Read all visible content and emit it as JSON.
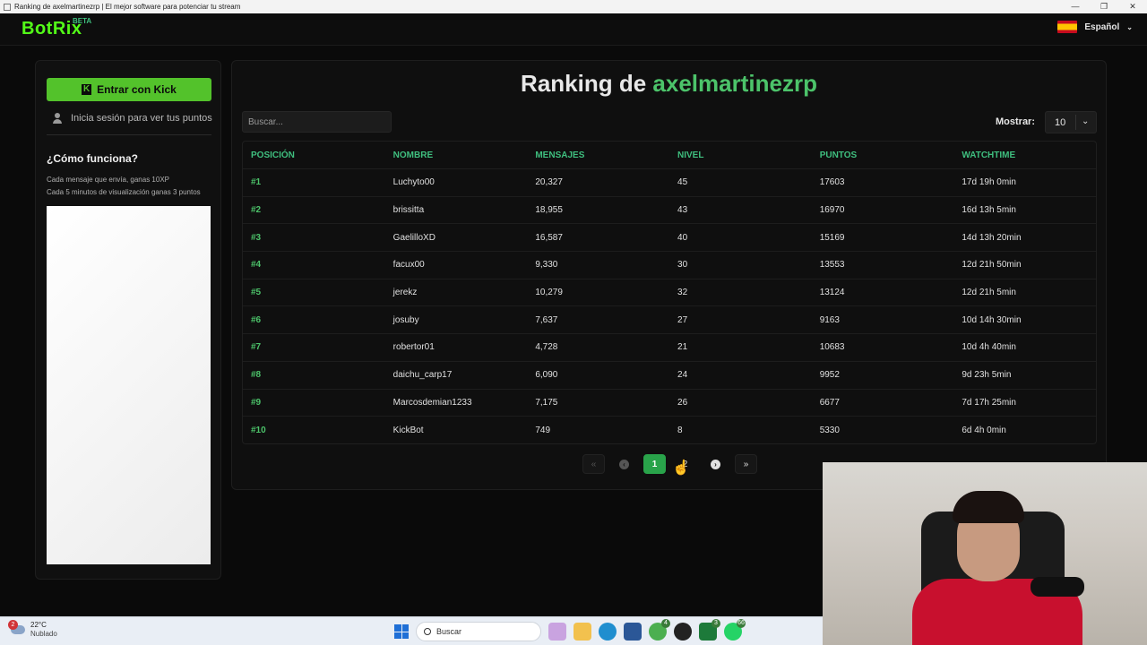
{
  "window": {
    "title": "Ranking de axelmartinezrp | El mejor software para potenciar tu stream",
    "controls": [
      "—",
      "❐",
      "✕"
    ]
  },
  "header": {
    "logo": "BotRix",
    "logo_badge": "BETA",
    "language": "Español",
    "language_flag_icon": "spain-flag-icon"
  },
  "sidebar": {
    "kick_button": "Entrar con Kick",
    "login_hint": "Inicia sesión para ver tus puntos",
    "how_title": "¿Cómo funciona?",
    "how_lines": [
      "Cada mensaje que envía, ganas 10XP",
      "Cada 5 minutos de visualización ganas 3 puntos"
    ]
  },
  "main": {
    "title_prefix": "Ranking de",
    "title_name": "axelmartinezrp",
    "search_placeholder": "Buscar...",
    "show_label": "Mostrar:",
    "show_value": "10",
    "columns": [
      "POSICIÓN",
      "NOMBRE",
      "MENSAJES",
      "NIVEL",
      "PUNTOS",
      "WATCHTIME"
    ],
    "rows": [
      [
        "#1",
        "Luchyto00",
        "20,327",
        "45",
        "17603",
        "17d 19h 0min"
      ],
      [
        "#2",
        "brissitta",
        "18,955",
        "43",
        "16970",
        "16d 13h 5min"
      ],
      [
        "#3",
        "GaelilloXD",
        "16,587",
        "40",
        "15169",
        "14d 13h 20min"
      ],
      [
        "#4",
        "facux00",
        "9,330",
        "30",
        "13553",
        "12d 21h 50min"
      ],
      [
        "#5",
        "jerekz",
        "10,279",
        "32",
        "13124",
        "12d 21h 5min"
      ],
      [
        "#6",
        "josuby",
        "7,637",
        "27",
        "9163",
        "10d 14h 30min"
      ],
      [
        "#7",
        "robertor01",
        "4,728",
        "21",
        "10683",
        "10d 4h 40min"
      ],
      [
        "#8",
        "daichu_carp17",
        "6,090",
        "24",
        "9952",
        "9d 23h 5min"
      ],
      [
        "#9",
        "Marcosdemian1233",
        "7,175",
        "26",
        "6677",
        "7d 17h 25min"
      ],
      [
        "#10",
        "KickBot",
        "749",
        "8",
        "5330",
        "6d 4h 0min"
      ]
    ],
    "pagination": {
      "first": "«",
      "prev": "‹",
      "pages": [
        "1",
        "2"
      ],
      "current": "1",
      "next": "›",
      "last": "»"
    }
  },
  "taskbar": {
    "weather_temp": "22°C",
    "weather_cond": "Nublado",
    "weather_badge": "2",
    "search_label": "Buscar",
    "app_badges": [
      "4",
      "3",
      "66"
    ]
  },
  "colors": {
    "brand_green": "#53fc18",
    "accent_green": "#4cc36a",
    "active_page": "#29a34a",
    "background": "#0a0a0a"
  }
}
